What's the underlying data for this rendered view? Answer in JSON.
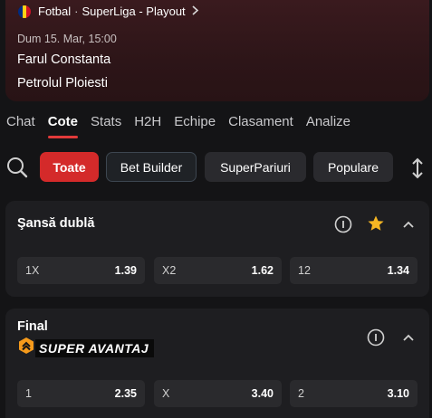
{
  "match": {
    "sport": "Fotbal",
    "competition": "SuperLiga - Playout",
    "date": "Dum 15. Mar, 15:00",
    "home_team": "Farul Constanta",
    "away_team": "Petrolul Ploiesti",
    "flag_colors": [
      "#002B7F",
      "#FCD116",
      "#CE1126"
    ]
  },
  "tabs": [
    {
      "label": "Chat",
      "active": false
    },
    {
      "label": "Cote",
      "active": true
    },
    {
      "label": "Stats",
      "active": false
    },
    {
      "label": "H2H",
      "active": false
    },
    {
      "label": "Echipe",
      "active": false
    },
    {
      "label": "Clasament",
      "active": false
    },
    {
      "label": "Analize",
      "active": false
    }
  ],
  "filters": [
    {
      "label": "Toate",
      "state": "active"
    },
    {
      "label": "Bet Builder",
      "state": "outlined"
    },
    {
      "label": "SuperPariuri",
      "state": "default"
    },
    {
      "label": "Populare",
      "state": "default"
    }
  ],
  "markets": [
    {
      "title": "Şansă dublă",
      "favorite": true,
      "odds": [
        {
          "label": "1X",
          "value": "1.39"
        },
        {
          "label": "X2",
          "value": "1.62"
        },
        {
          "label": "12",
          "value": "1.34"
        }
      ]
    },
    {
      "title": "Final",
      "promo_label": "SUPER AVANTAJ",
      "odds": [
        {
          "label": "1",
          "value": "2.35"
        },
        {
          "label": "X",
          "value": "3.40"
        },
        {
          "label": "2",
          "value": "3.10"
        }
      ]
    }
  ],
  "colors": {
    "accent_red": "#d42a2a",
    "star_gold": "#f5b623",
    "promo_orange": "#f59a1b",
    "background": "#141416"
  },
  "icons": [
    "flag-icon",
    "chevron-right-icon",
    "search-icon",
    "sort-icon",
    "info-icon",
    "star-icon",
    "chevron-up-icon",
    "super-avantaj-badge-icon"
  ]
}
